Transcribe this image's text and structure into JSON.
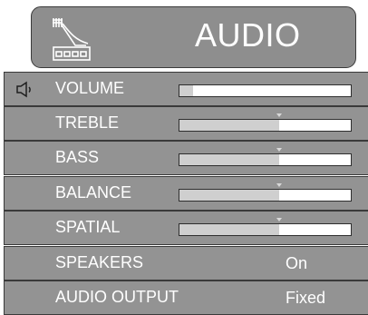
{
  "header": {
    "title": "AUDIO",
    "icon": "gramophone-icon"
  },
  "rows": [
    {
      "label": "VOLUME",
      "type": "slider",
      "level": 0.08,
      "center_mark": false,
      "icon": "speaker-icon"
    },
    {
      "label": "TREBLE",
      "type": "slider",
      "level": 0.58,
      "center_mark": true
    },
    {
      "label": "BASS",
      "type": "slider",
      "level": 0.58,
      "center_mark": true
    },
    {
      "label": "BALANCE",
      "type": "slider",
      "level": 0.58,
      "center_mark": true
    },
    {
      "label": "SPATIAL",
      "type": "slider",
      "level": 0.58,
      "center_mark": true
    },
    {
      "label": "SPEAKERS",
      "type": "value",
      "value": "On"
    },
    {
      "label": "AUDIO OUTPUT",
      "type": "value",
      "value": "Fixed"
    }
  ],
  "colors": {
    "row_bg": "#939393",
    "slider_fill": "#cfcfcf",
    "text": "#ffffff"
  }
}
